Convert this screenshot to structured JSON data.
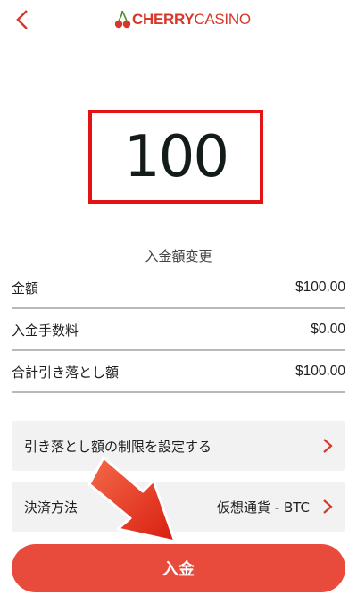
{
  "header": {
    "brand_cherry": "CHERRY",
    "brand_casino": "CASINO",
    "back_icon": "chevron-left-icon",
    "logo_icon": "cherry-logo-icon"
  },
  "amount": {
    "value": "100"
  },
  "change_amount_label": "入金額変更",
  "summary": {
    "amount_label": "金額",
    "amount_value": "$100.00",
    "fee_label": "入金手数料",
    "fee_value": "$0.00",
    "total_label": "合計引き落とし額",
    "total_value": "$100.00"
  },
  "limits_card": {
    "label": "引き落とし額の制限を設定する"
  },
  "payment_card": {
    "label": "決済方法",
    "value": "仮想通貨 - BTC"
  },
  "deposit_button": {
    "label": "入金"
  },
  "colors": {
    "accent_red": "#e84a3c",
    "highlight_box": "#e31313",
    "card_bg": "#f2f2f2"
  }
}
